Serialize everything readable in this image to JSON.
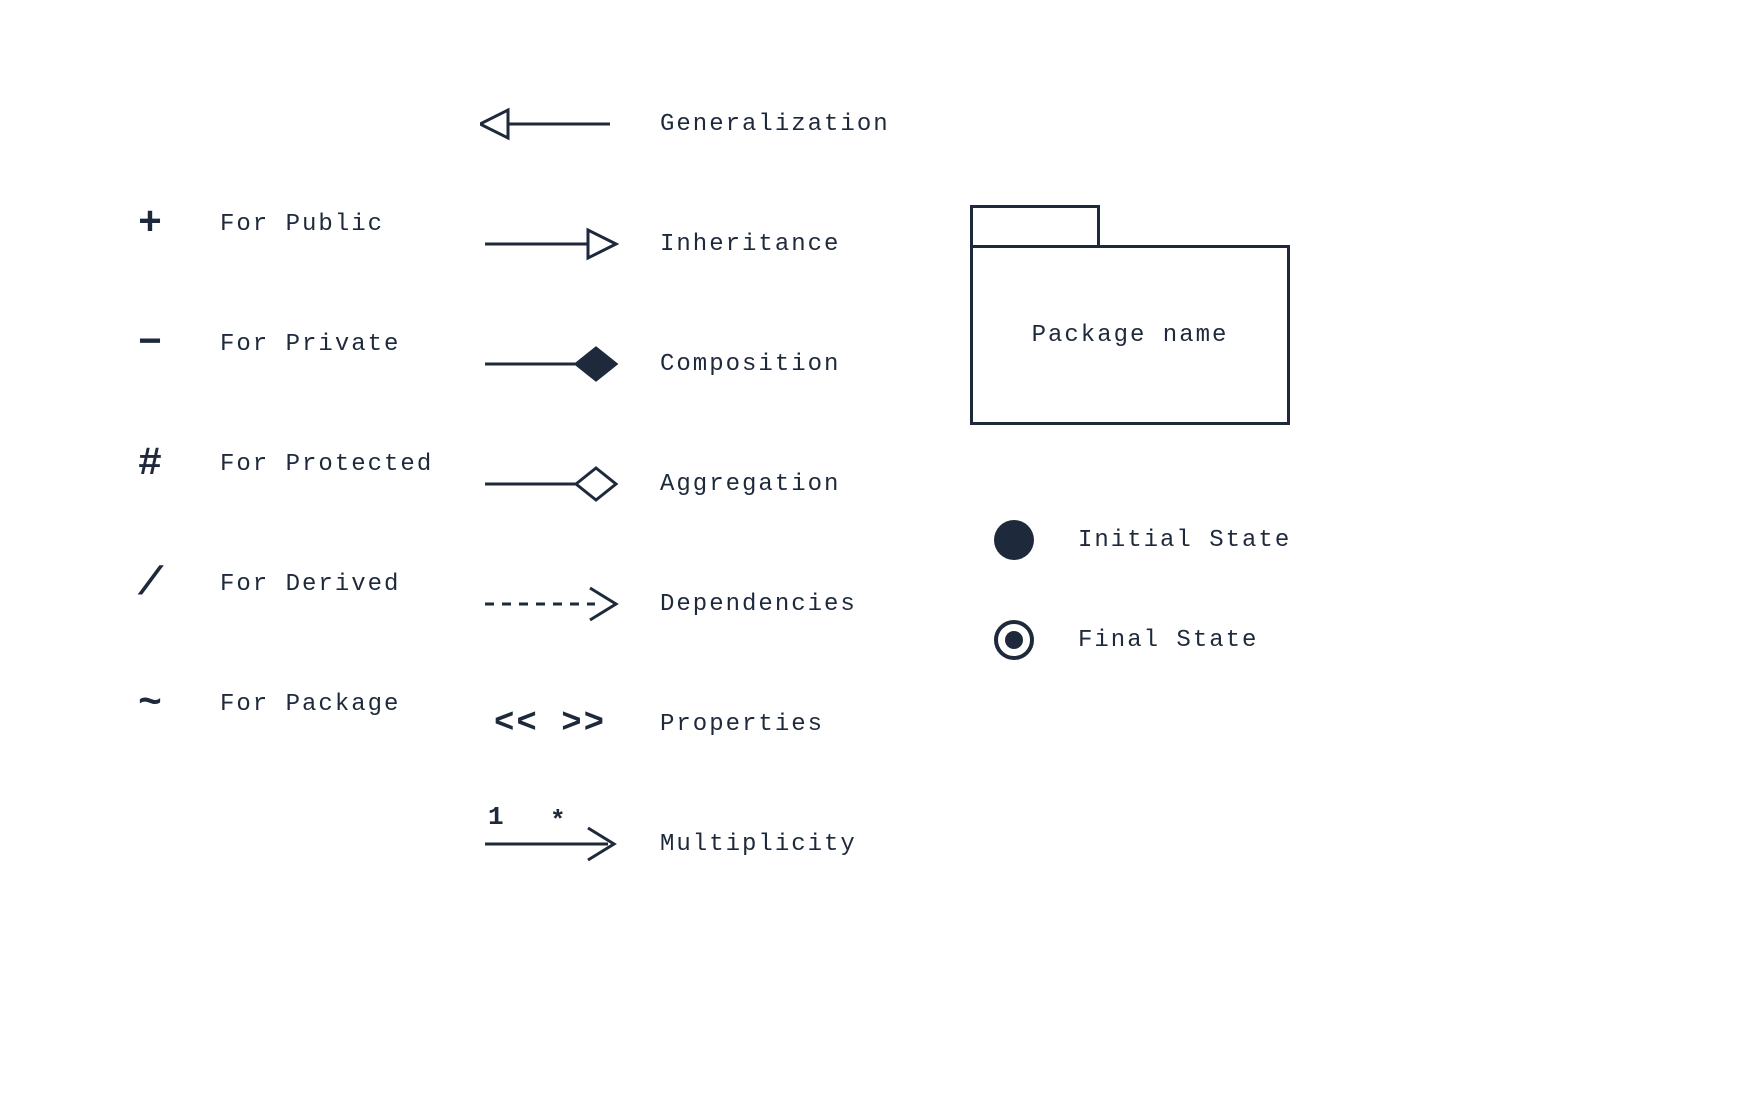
{
  "visibility": {
    "public": {
      "symbol": "+",
      "label": "For Public"
    },
    "private": {
      "symbol": "−",
      "label": "For Private"
    },
    "protected": {
      "symbol": "#",
      "label": "For Protected"
    },
    "derived": {
      "symbol": "/",
      "label": "For Derived"
    },
    "package": {
      "symbol": "~",
      "label": "For Package"
    }
  },
  "relations": {
    "generalization": {
      "label": "Generalization"
    },
    "inheritance": {
      "label": "Inheritance"
    },
    "composition": {
      "label": "Composition"
    },
    "aggregation": {
      "label": "Aggregation"
    },
    "dependencies": {
      "label": "Dependencies"
    },
    "properties": {
      "label": "Properties",
      "glyph": "<< >>"
    },
    "multiplicity": {
      "label": "Multiplicity",
      "left": "1",
      "right": "*"
    }
  },
  "package": {
    "label": "Package name"
  },
  "states": {
    "initial": {
      "label": "Initial State"
    },
    "final": {
      "label": "Final State"
    }
  },
  "colors": {
    "ink": "#1e2a3b"
  }
}
